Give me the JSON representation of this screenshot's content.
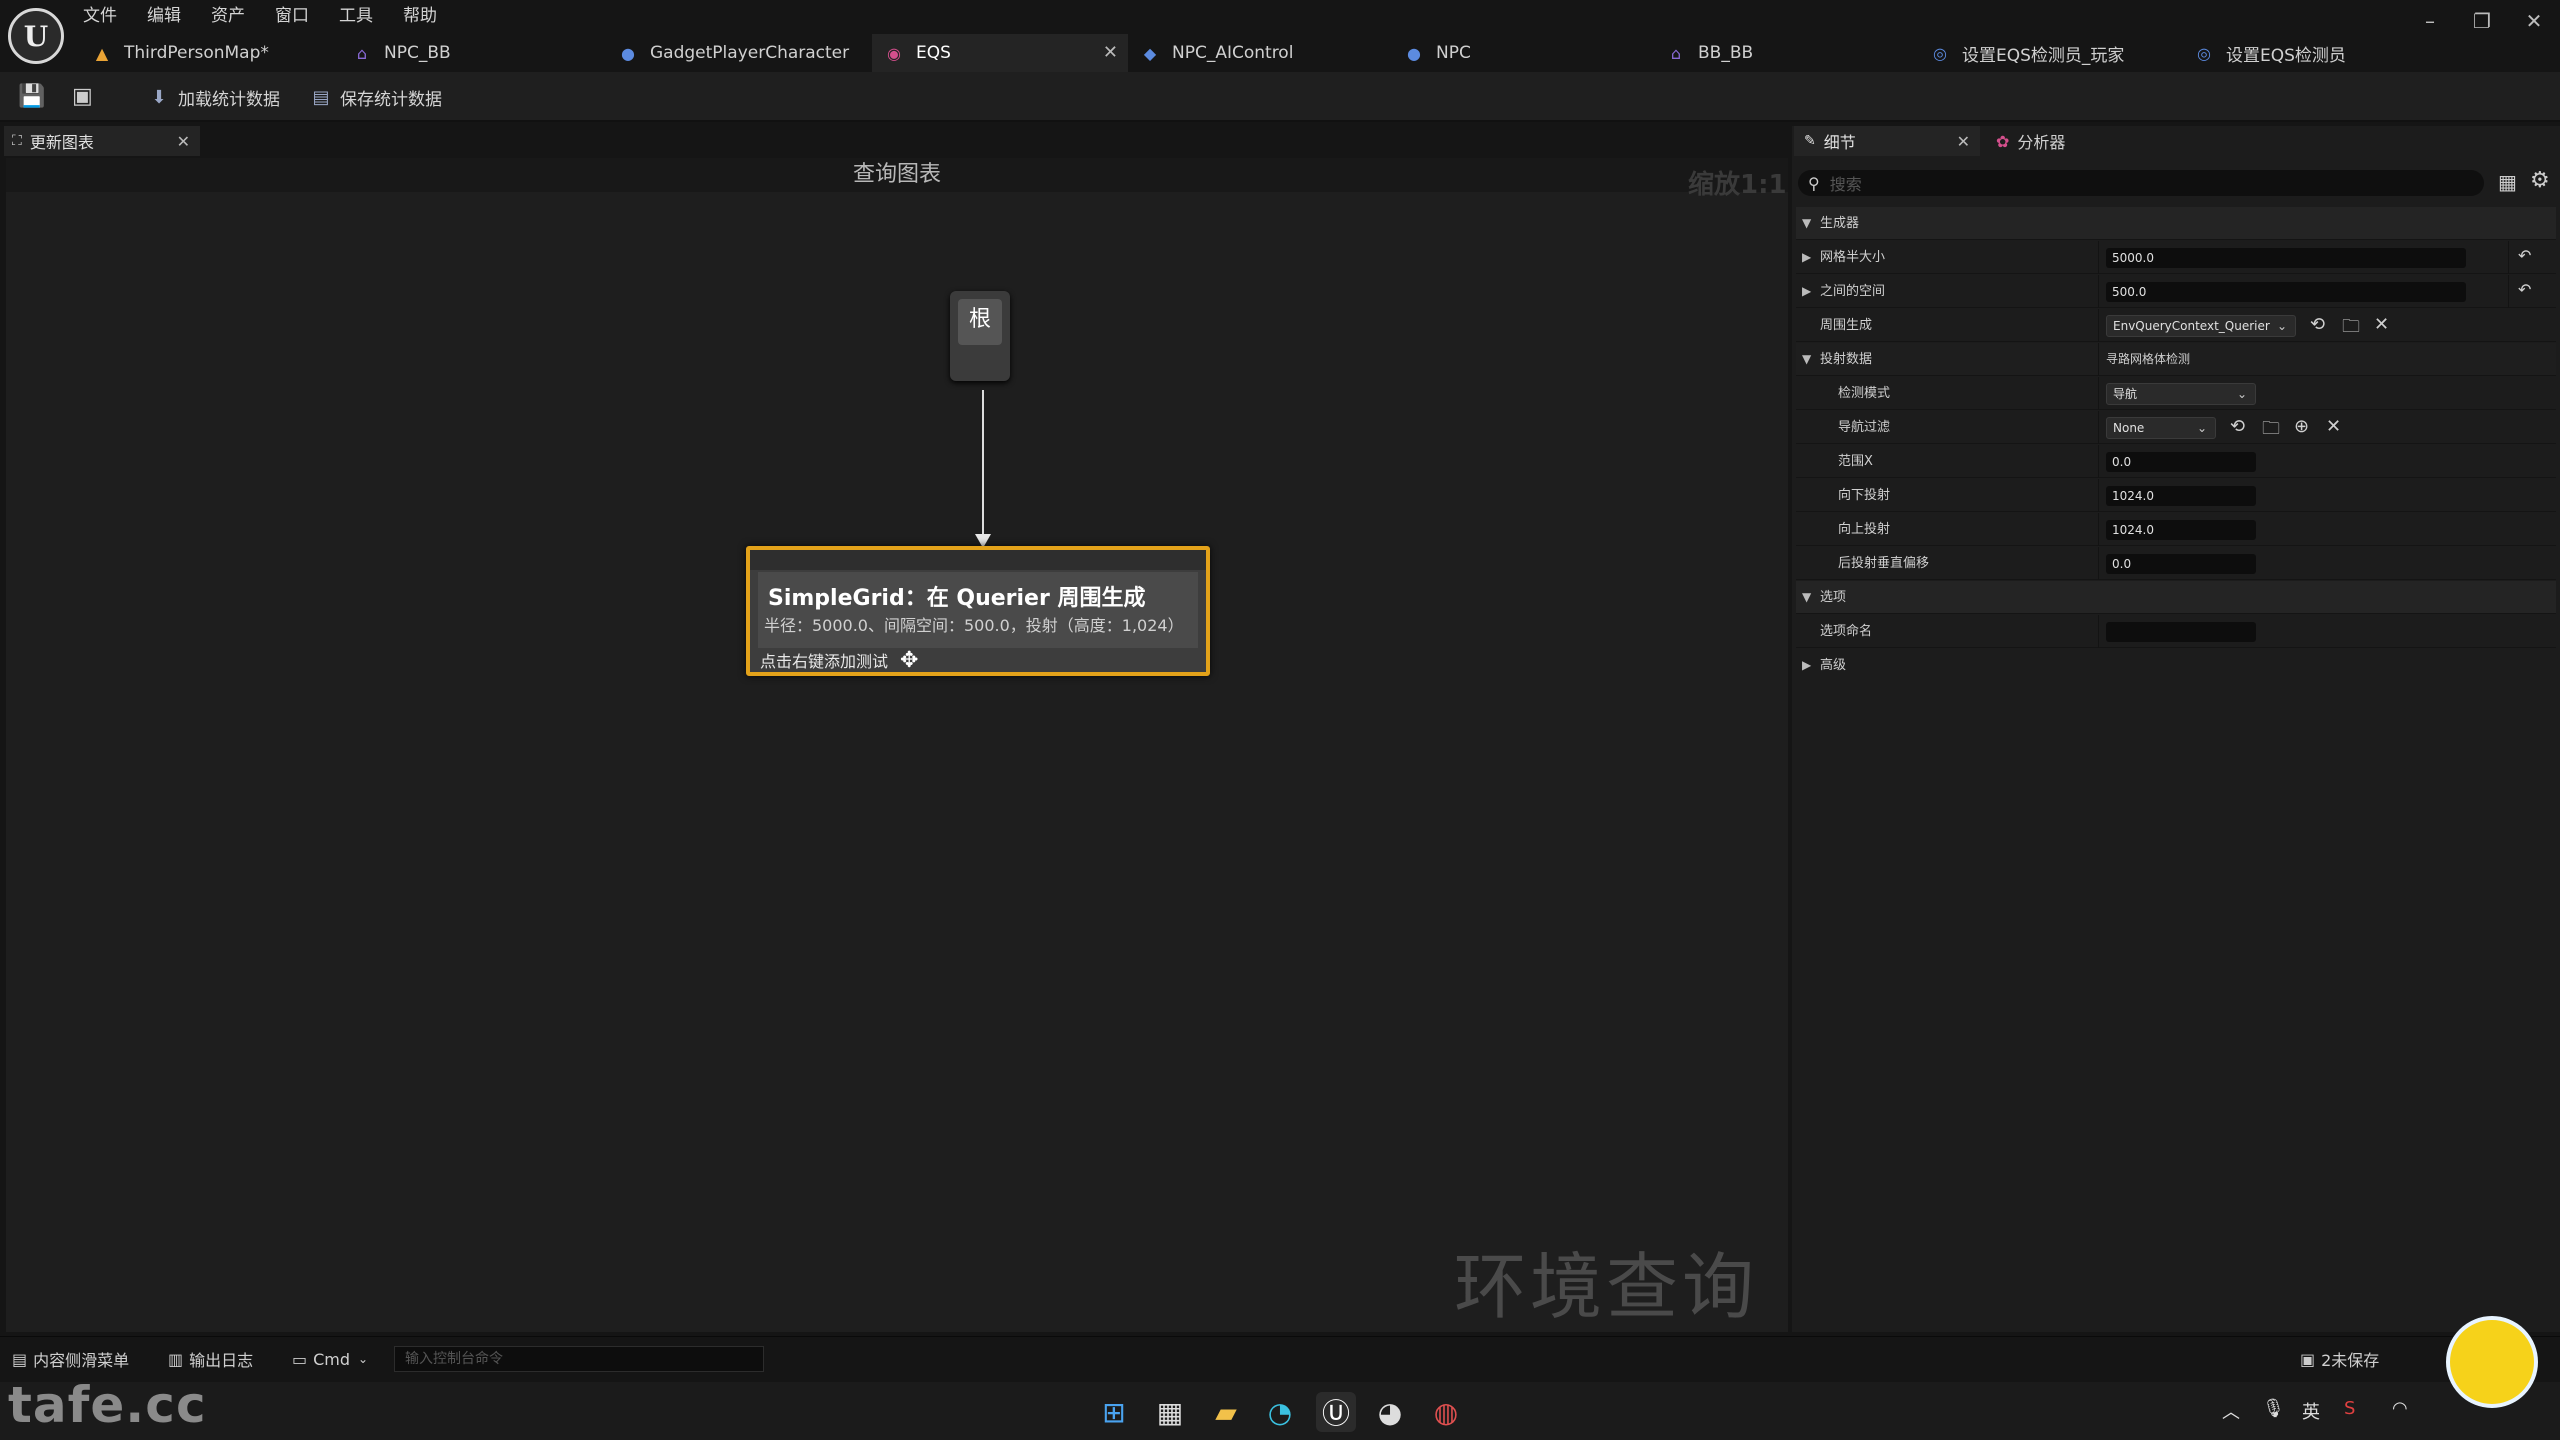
{
  "menu": [
    "文件",
    "编辑",
    "资产",
    "窗口",
    "工具",
    "帮助"
  ],
  "tabs": [
    {
      "label": "ThirdPersonMap*",
      "icon": "level-icon",
      "color": "#e9a335"
    },
    {
      "label": "NPC_BB",
      "icon": "blackboard-icon",
      "color": "#8a6ad8"
    },
    {
      "label": "GadgetPlayerCharacter",
      "icon": "character-icon",
      "color": "#5c8be0"
    },
    {
      "label": "EQS",
      "icon": "eqs-icon",
      "color": "#d34f8c"
    },
    {
      "label": "NPC_AIControl",
      "icon": "aicontroller-icon",
      "color": "#5c8be0"
    },
    {
      "label": "NPC",
      "icon": "character-icon",
      "color": "#5c8be0"
    },
    {
      "label": "BB_BB",
      "icon": "blackboard-icon",
      "color": "#8a6ad8"
    },
    {
      "label": "设置EQS检测员_玩家",
      "icon": "blueprint-icon",
      "color": "#5c8be0"
    },
    {
      "label": "设置EQS检测员",
      "icon": "blueprint-icon",
      "color": "#5c8be0"
    }
  ],
  "toolbar": {
    "load_stats": "加载统计数据",
    "save_stats": "保存统计数据"
  },
  "graph": {
    "tab_label": "更新图表",
    "header": "查询图表",
    "zoom": "缩放1:1",
    "watermark": "环境查询",
    "root_label": "根",
    "generator": {
      "title": "SimpleGrid：在 Querier 周围生成",
      "desc": "半径：5000.0、间隔空间：500.0，投射（高度：1,024）",
      "hint": "点击右键添加测试"
    }
  },
  "details": {
    "tab_label": "细节",
    "profiler_label": "分析器",
    "search_placeholder": "搜索",
    "generator_cat": "生成器",
    "grid_half_size_label": "网格半大小",
    "grid_half_size_value": "5000.0",
    "space_between_label": "之间的空间",
    "space_between_value": "500.0",
    "generate_around_label": "周围生成",
    "generate_around_value": "EnvQueryContext_Querier",
    "projection_label": "投射数据",
    "projection_value": "寻路网格体检测",
    "trace_mode_label": "检测模式",
    "trace_mode_value": "导航",
    "nav_filter_label": "导航过滤",
    "nav_filter_value": "None",
    "extent_x_label": "范围X",
    "extent_x_value": "0.0",
    "project_down_label": "向下投射",
    "project_down_value": "1024.0",
    "project_up_label": "向上投射",
    "project_up_value": "1024.0",
    "post_projection_label": "后投射垂直偏移",
    "post_projection_value": "0.0",
    "option_cat": "选项",
    "option_name_label": "选项命名",
    "option_name_value": "",
    "advanced_label": "高级"
  },
  "bottom": {
    "content_drawer": "内容侧滑菜单",
    "output_log": "输出日志",
    "cmd": "Cmd",
    "console_placeholder": "输入控制台命令",
    "unsaved": "2未保存"
  },
  "taskbar": {
    "logo_text": "tafe.cc",
    "lang": "英",
    "icons": [
      "windows-start-icon",
      "store-icon",
      "file-explorer-icon",
      "edge-icon",
      "unreal-icon",
      "epic-icon",
      "chrome-icon"
    ]
  },
  "colors": {
    "accent_orange": "#e3a21a",
    "bg": "#151515",
    "panel": "#1c1c1c"
  }
}
